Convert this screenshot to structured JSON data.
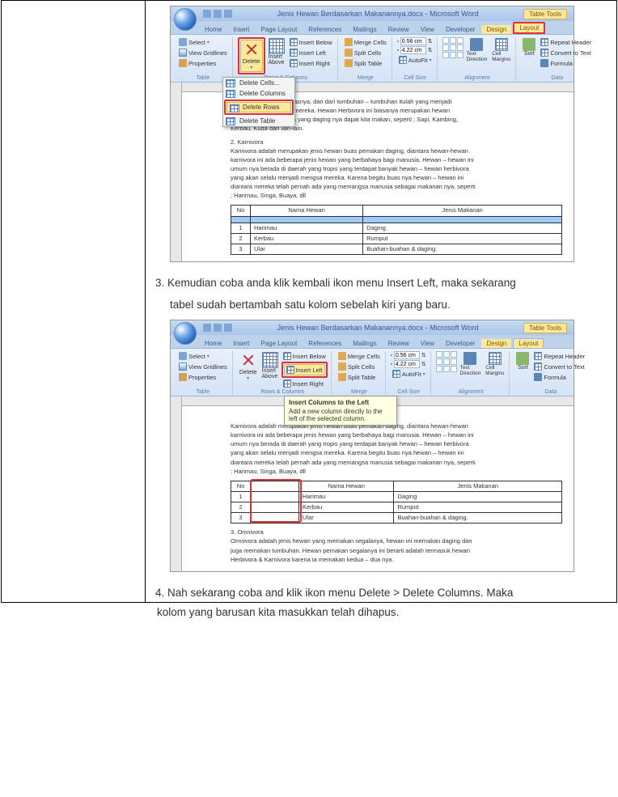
{
  "word": {
    "title": "Jenis Hewan Berdasarkan Makanannya.docx - Microsoft Word",
    "table_tools": "Table Tools",
    "tabs": {
      "home": "Home",
      "insert": "Insert",
      "page_layout": "Page Layout",
      "references": "References",
      "mailings": "Mailings",
      "review": "Review",
      "view": "View",
      "developer": "Developer",
      "design": "Design",
      "layout": "Layout"
    },
    "ribbon": {
      "select": "Select",
      "view_gridlines": "View Gridlines",
      "properties": "Properties",
      "table_group": "Table",
      "delete": "Delete",
      "insert_above": "Insert Above",
      "insert_below": "Insert Below",
      "insert_left": "Insert Left",
      "insert_right": "Insert Right",
      "rows_columns": "Rows & Columns",
      "merge_cells": "Merge Cells",
      "split_cells": "Split Cells",
      "split_table": "Split Table",
      "merge_group": "Merge",
      "height": "0.56 cm",
      "width": "4.22 cm",
      "autofit": "AutoFit",
      "cell_size": "Cell Size",
      "text_direction": "Text Direction",
      "cell_margins": "Cell Margins",
      "alignment": "Alignment",
      "sort": "Sort",
      "repeat_header": "Repeat Header",
      "convert_text": "Convert to Text",
      "formula": "Formula",
      "data_group": "Data"
    },
    "delete_menu": {
      "cells": "Delete Cells...",
      "columns": "Delete Columns",
      "rows": "Delete Rows",
      "table": "Delete Table"
    },
    "tooltip": {
      "title": "Insert Columns to the Left",
      "body": "Add a new column directly to the left of the selected column."
    }
  },
  "doc": {
    "frag1_l1": "ahan hijau tumbuh di atasnya, dan dari tumbuhan – tumbuhan itulah yang menjadi",
    "frag1_l2": "er makanan kehidupan mereka. Hewan Herbivora ini biasanya merupakan hewan",
    "frag1_l3": "yang akrab ditelinga kita yang daging nya dapat kita makan, seperti ; Sapi, Kambing,",
    "frag1_l4": "Kerbau, Kuda dan lain-lain.",
    "s2_title": "2. Karnivora",
    "s2_p1": "Karnivora adalah merupakan jenis hewan buas pemakan daging, diantara hewan-hewan",
    "s2_p2": "karnivora ini ada beberapa jenis hewan yang berbahaya bagi manusia. Hewan – hewan ini",
    "s2_p3": "umum nya berada di daerah yang tropis yang terdapat banyak hewan – hewan herbivora",
    "s2_p4": "yang akan selalu menjadi mengsa mereka. Karena begitu buas nya hewan – hewan ini",
    "s2_p5": "diantara mereka telah pernah ada yang memangsa manusia sebagai makanan nya, seperti",
    "s2_p6": "; Harimau, Singa, Buaya, dll",
    "s3_title": "3. Omnivora",
    "s3_p1": "Omnivora adalah jenis hewan yang memakan segalanya, hewan ini memakan daging dan",
    "s3_p2": "juga memakan tumbuhan. Hewan pemakan segalanya ini berarti adalah termasuk hewan",
    "s3_p3": "Herbivora & Karnivora karena ia memakan kedua – dua nya.",
    "table": {
      "h_no": "No",
      "h_nama": "Nama Hewan",
      "h_jenis": "Jenis Makanan",
      "rows": [
        {
          "no": "1",
          "nama": "Harimau",
          "jenis": "Daging"
        },
        {
          "no": "2",
          "nama": "Kerbau",
          "jenis": "Rumput"
        },
        {
          "no": "3",
          "nama": "Ular",
          "jenis": "Buahan-buahan & daging."
        }
      ]
    }
  },
  "instructions": {
    "step3a": "3. Kemudian coba anda klik kembali ikon menu Insert Left, maka sekarang",
    "step3b": "tabel sudah bertambah satu kolom sebelah kiri yang baru.",
    "step4": "4. Nah sekarang coba and klik ikon menu  Delete > Delete Columns. Maka",
    "step4b": "kolom yang barusan kita masukkan telah dihapus."
  }
}
